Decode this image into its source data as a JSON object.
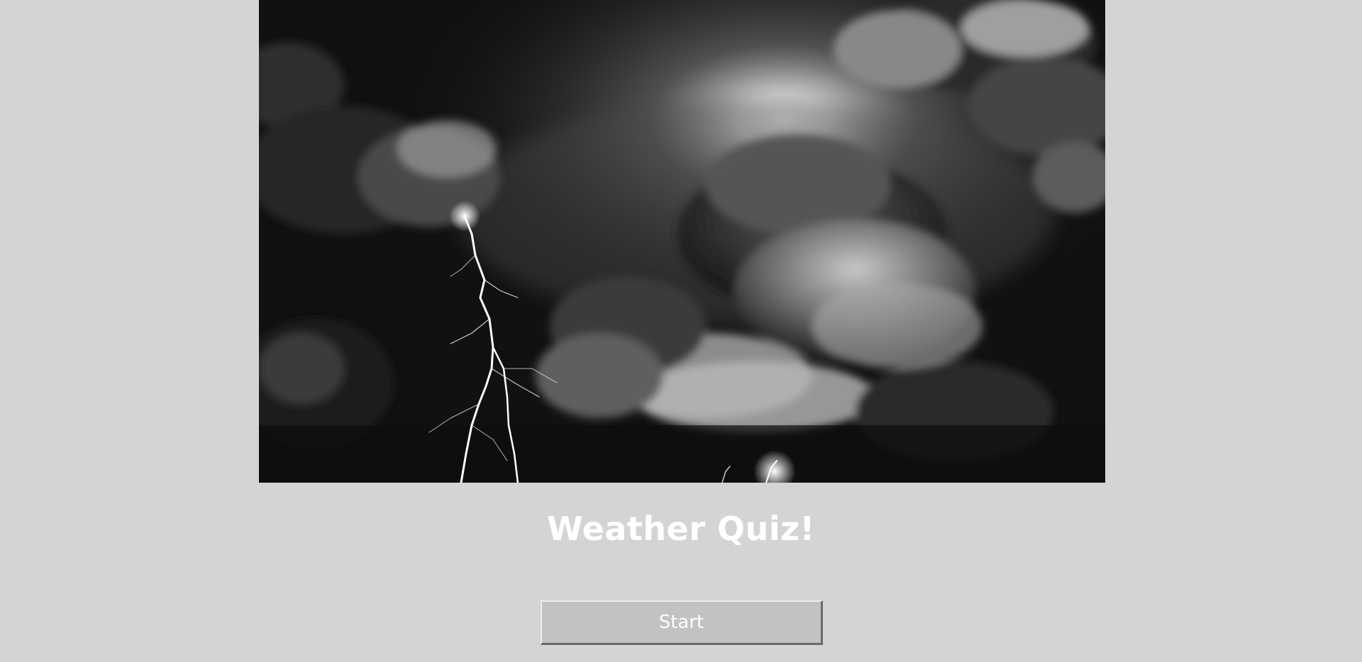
{
  "hero": {
    "image": "storm-clouds-lightning",
    "palette": [
      "#0c0c0c",
      "#3a3a3a",
      "#9a9a9a",
      "#ffffff"
    ]
  },
  "quiz": {
    "title": "Weather Quiz!"
  },
  "controls": {
    "start_label": "Start"
  },
  "colors": {
    "background": "#d4d4d4",
    "button": "#c2c2c2",
    "text": "#ffffff"
  }
}
